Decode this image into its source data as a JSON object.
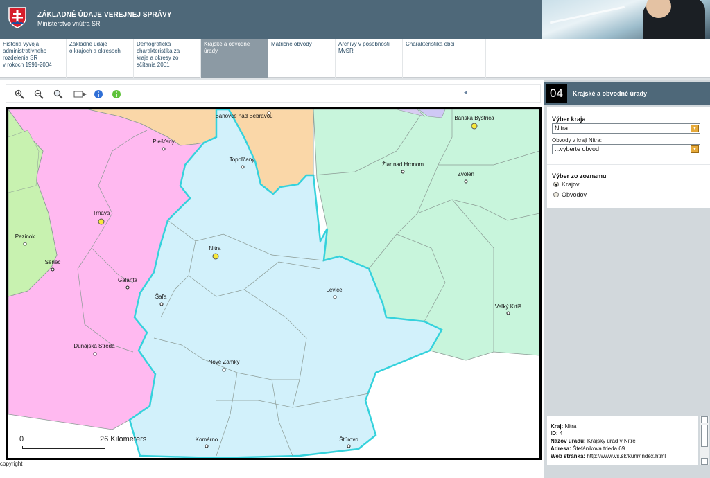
{
  "header": {
    "title": "ZÁKLADNÉ ÚDAJE VEREJNEJ SPRÁVY",
    "subtitle": "Ministerstvo vnútra SR"
  },
  "nav": {
    "tabs": [
      {
        "label": "História vývoja\nadministratívneho\nrozdelenia SR\nv rokoch 1991-2004",
        "active": false
      },
      {
        "label": "Základné údaje\no  krajoch a okresoch",
        "active": false
      },
      {
        "label": "Demografická\ncharakteristika za\nkraje a okresy zo\nsčítania 2001",
        "active": false
      },
      {
        "label": "Krajské a obvodné\núrady",
        "active": true
      },
      {
        "label": "Matričné obvody",
        "active": false
      },
      {
        "label": "Archívy v pôsobnosti\nMvSR",
        "active": false
      },
      {
        "label": "Charakteristika obcí",
        "active": false
      }
    ]
  },
  "toolbar": {
    "tools": [
      "zoom-in-icon",
      "zoom-out-icon",
      "zoom-extent-icon",
      "pan-icon",
      "info-icon",
      "identify-icon"
    ]
  },
  "map": {
    "cities": [
      {
        "name": "Bánovce nad Bebravou",
        "kind": "small"
      },
      {
        "name": "Piešťany",
        "kind": "small"
      },
      {
        "name": "Topoľčany",
        "kind": "small"
      },
      {
        "name": "Trnava",
        "kind": "capital"
      },
      {
        "name": "Pezinok",
        "kind": "small"
      },
      {
        "name": "Senec",
        "kind": "small"
      },
      {
        "name": "Nitra",
        "kind": "capital"
      },
      {
        "name": "Galanta",
        "kind": "small"
      },
      {
        "name": "Šaľa",
        "kind": "small"
      },
      {
        "name": "Levice",
        "kind": "small"
      },
      {
        "name": "Dunajská Streda",
        "kind": "small"
      },
      {
        "name": "Nové Zámky",
        "kind": "small"
      },
      {
        "name": "Komárno",
        "kind": "small"
      },
      {
        "name": "Štúrovo",
        "kind": "small"
      },
      {
        "name": "Banská Bystrica",
        "kind": "capital"
      },
      {
        "name": "Žiar nad Hronom",
        "kind": "small"
      },
      {
        "name": "Zvolen",
        "kind": "small"
      },
      {
        "name": "Veľký Krtíš",
        "kind": "small"
      }
    ],
    "scale_zero": "0",
    "scale_label": "26 Kilometers",
    "colors": {
      "trnava": "#ffb9f0",
      "bratislava": "#c8f2b0",
      "trencin": "#fad7a8",
      "nitra": "#d2f1fb",
      "banska_bystrica": "#c8f5dc",
      "selected_border": "#35d2dc"
    }
  },
  "copyright": "copyright",
  "panel": {
    "number": "04",
    "title": "Krajské a obvodné úrady",
    "kraj_label": "Výber kraja",
    "kraj_value": "Nitra",
    "obvod_label": "Obvody v kraji Nitra:",
    "obvod_value": "...vyberte obvod",
    "list_label": "Výber zo zoznamu",
    "radio_krajov": "Krajov",
    "radio_obvodov": "Obvodov",
    "info": {
      "kraj_key": "Kraj:",
      "kraj_val": "Nitra",
      "id_key": "ID:",
      "id_val": "4",
      "nazov_key": "Názov úradu:",
      "nazov_val": "Krajský úrad v Nitre",
      "adresa_key": "Adresa:",
      "adresa_val": "Štefánikova trieda 69",
      "web_key": "Web stránka:",
      "web_val": "http://www.vs.sk/kunr/index.html"
    }
  }
}
